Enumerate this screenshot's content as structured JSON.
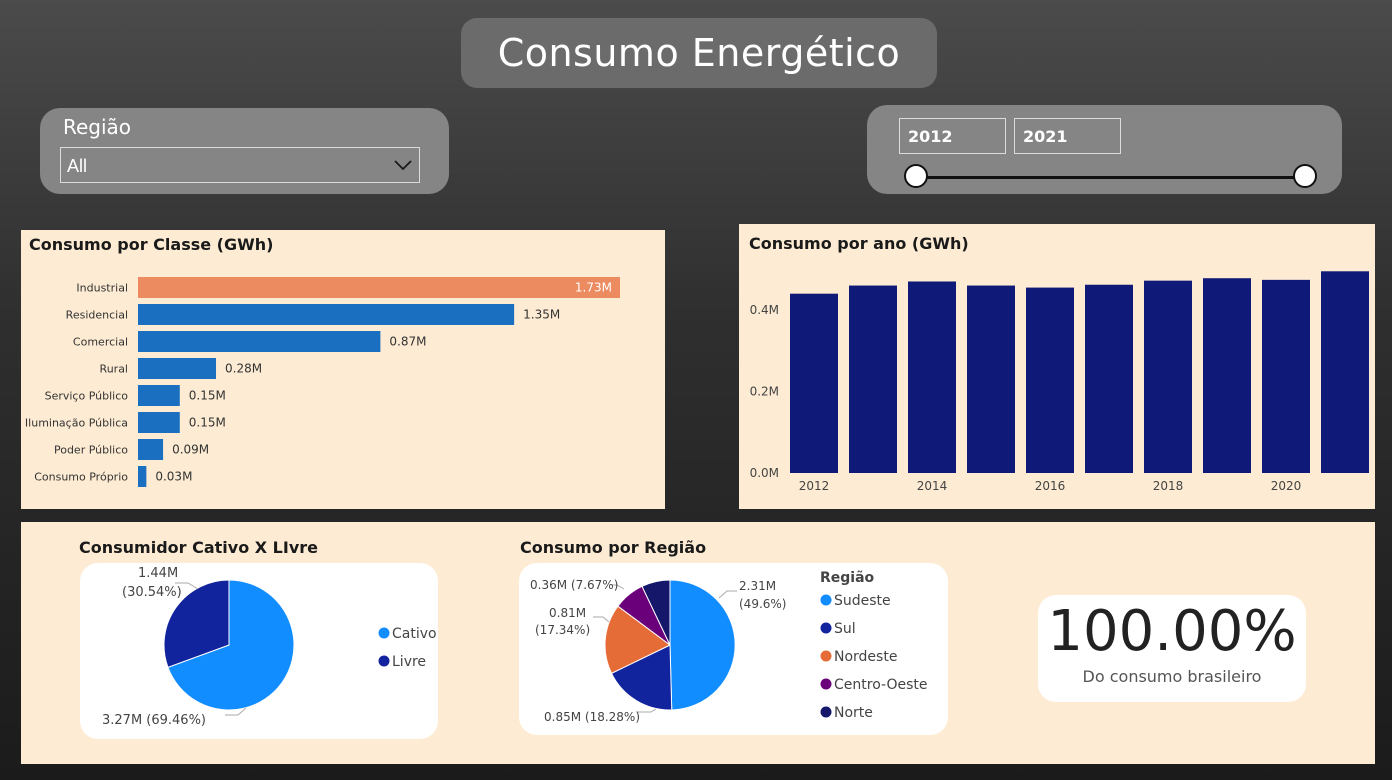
{
  "header": {
    "title": "Consumo Energético"
  },
  "filters": {
    "region_label": "Região",
    "region_value": "All",
    "year_start": "2012",
    "year_end": "2021"
  },
  "colors": {
    "highlight": "#ec8a60",
    "bar_blue": "#1a6fc0",
    "navy": "#0f1a78",
    "panel_bg": "#fdecd3"
  },
  "icons": {
    "dropdown": "chevron-down-icon"
  },
  "kpi": {
    "value": "100.00%",
    "label": "Do consumo brasileiro"
  },
  "chart_data": [
    {
      "type": "bar",
      "orientation": "horizontal",
      "title": "Consumo por Classe (GWh)",
      "categories": [
        "Industrial",
        "Residencial",
        "Comercial",
        "Rural",
        "Serviço Público",
        "Iluminação Pública",
        "Poder Público",
        "Consumo Próprio"
      ],
      "values": [
        1.73,
        1.35,
        0.87,
        0.28,
        0.15,
        0.15,
        0.09,
        0.03
      ],
      "labels": [
        "1.73M",
        "1.35M",
        "0.87M",
        "0.28M",
        "0.15M",
        "0.15M",
        "0.09M",
        "0.03M"
      ],
      "unit": "M",
      "xlim": [
        0,
        1.8
      ],
      "highlight_index": 0
    },
    {
      "type": "bar",
      "title": "Consumo por ano (GWh)",
      "x": [
        2012,
        2013,
        2014,
        2015,
        2016,
        2017,
        2018,
        2019,
        2020,
        2021
      ],
      "values": [
        0.44,
        0.46,
        0.47,
        0.46,
        0.455,
        0.462,
        0.472,
        0.478,
        0.474,
        0.495
      ],
      "xticks": [
        "2012",
        "2014",
        "2016",
        "2018",
        "2020"
      ],
      "yticks": [
        "0.0M",
        "0.2M",
        "0.4M"
      ],
      "ylim": [
        0,
        0.5
      ],
      "grid": false
    },
    {
      "type": "pie",
      "title": "Consumidor Cativo X LIvre",
      "slices": [
        {
          "name": "Cativo",
          "value": 3.27,
          "percent": 69.46,
          "label": "3.27M (69.46%)",
          "color": "#118dff"
        },
        {
          "name": "Livre",
          "value": 1.44,
          "percent": 30.54,
          "label_line1": "1.44M",
          "label_line2": "(30.54%)",
          "color": "#12239e"
        }
      ],
      "legend_position": "right"
    },
    {
      "type": "pie",
      "title": "Consumo por Região",
      "legend_title": "Região",
      "slices": [
        {
          "name": "Sudeste",
          "value": 2.31,
          "percent": 49.6,
          "label_line1": "2.31M",
          "label_line2": "(49.6%)",
          "color": "#118dff"
        },
        {
          "name": "Sul",
          "value": 0.85,
          "percent": 18.28,
          "label": "0.85M (18.28%)",
          "color": "#12239e"
        },
        {
          "name": "Nordeste",
          "value": 0.81,
          "percent": 17.34,
          "label_line1": "0.81M",
          "label_line2": "(17.34%)",
          "color": "#e66c37"
        },
        {
          "name": "Centro-Oeste",
          "value": 0.36,
          "percent": 7.67,
          "label": "0.36M (7.67%)",
          "color": "#6b007b"
        },
        {
          "name": "Norte",
          "value": 0.33,
          "percent": 7.11,
          "color": "#14176a"
        }
      ],
      "legend_position": "right"
    }
  ]
}
